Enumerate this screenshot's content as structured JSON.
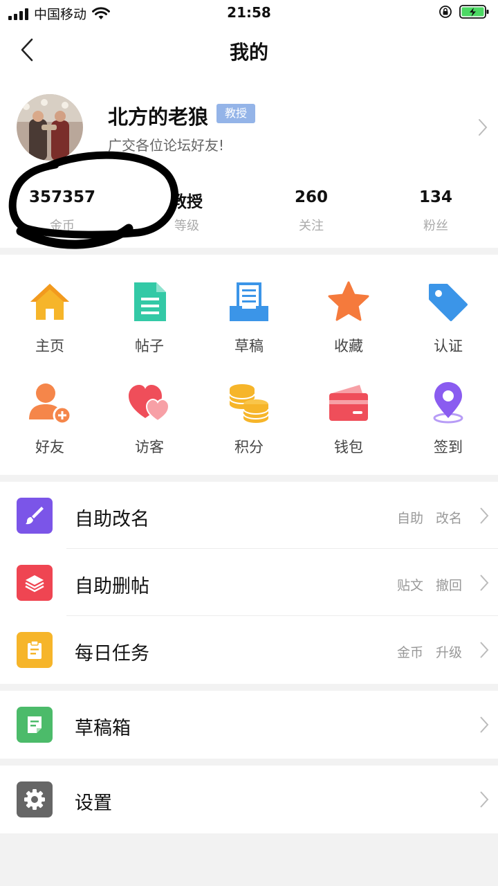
{
  "status_bar": {
    "carrier": "中国移动",
    "time": "21:58"
  },
  "nav": {
    "title": "我的"
  },
  "profile": {
    "name": "北方的老狼",
    "badge": "教授",
    "bio": "广交各位论坛好友!",
    "stats": [
      {
        "value": "357357",
        "label": "金币"
      },
      {
        "value": "教授",
        "label": "等级"
      },
      {
        "value": "260",
        "label": "关注"
      },
      {
        "value": "134",
        "label": "粉丝"
      }
    ]
  },
  "grid": [
    {
      "label": "主页",
      "icon": "home-icon",
      "color": "#f6b52a"
    },
    {
      "label": "帖子",
      "icon": "document-icon",
      "color": "#33c9a6"
    },
    {
      "label": "草稿",
      "icon": "draft-tray-icon",
      "color": "#3b95e8"
    },
    {
      "label": "收藏",
      "icon": "star-icon",
      "color": "#f57a3c"
    },
    {
      "label": "认证",
      "icon": "tag-icon",
      "color": "#3b95e8"
    },
    {
      "label": "好友",
      "icon": "add-friend-icon",
      "color": "#f5864a"
    },
    {
      "label": "访客",
      "icon": "hearts-icon",
      "color": "#ef4e5a"
    },
    {
      "label": "积分",
      "icon": "coins-icon",
      "color": "#f6b52a"
    },
    {
      "label": "钱包",
      "icon": "wallet-icon",
      "color": "#ef4e5a"
    },
    {
      "label": "签到",
      "icon": "location-pin-icon",
      "color": "#8a5cf0"
    }
  ],
  "menu": {
    "rename": {
      "title": "自助改名",
      "hint": "自助 改名",
      "icon": "brush-icon",
      "color": "#7b55e8"
    },
    "delete_post": {
      "title": "自助删帖",
      "hint": "贴文 撤回",
      "icon": "layers-icon",
      "color": "#ef4552"
    },
    "daily_task": {
      "title": "每日任务",
      "hint": "金币 升级",
      "icon": "clipboard-icon",
      "color": "#f6b52a"
    },
    "drafts": {
      "title": "草稿箱",
      "icon": "note-icon",
      "color": "#4cbb6a"
    },
    "settings": {
      "title": "设置",
      "icon": "gear-icon",
      "color": "#666666"
    }
  }
}
